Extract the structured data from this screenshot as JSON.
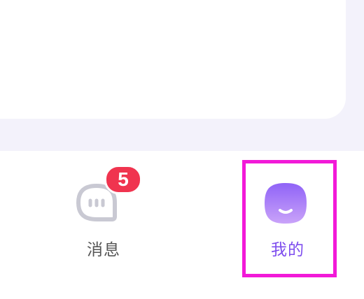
{
  "tabbar": {
    "items": [
      {
        "label": "消息",
        "icon": "message-icon",
        "badge": "5",
        "active": false
      },
      {
        "label": "我的",
        "icon": "smiley-avatar-icon",
        "active": true
      }
    ]
  },
  "colors": {
    "background": "#f3f2fb",
    "badge": "#f0344f",
    "active_label": "#7e4dee",
    "inactive_label": "#555555",
    "highlight": "#f219d8"
  }
}
